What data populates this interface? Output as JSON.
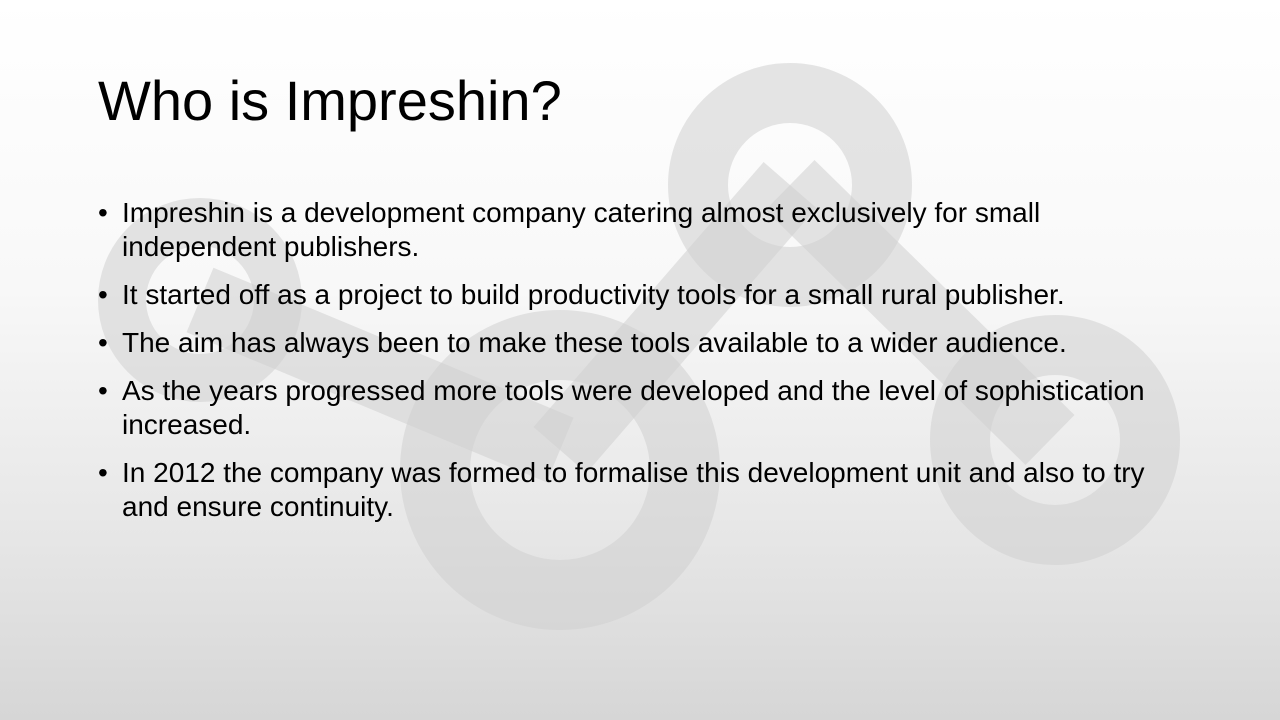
{
  "slide": {
    "title": "Who is Impreshin?",
    "bullet_glyph": "•",
    "watermark_icon": "share-network-icon",
    "bullets": [
      "Impreshin is a development company catering almost exclusively for small independent publishers.",
      "It started off as a project to build productivity tools for a small rural publisher.",
      "The aim has always been to make these tools available to a wider audience.",
      "As the years progressed more tools were developed and the level of sophistication increased.",
      "In 2012 the company was formed to formalise this development unit and also to try and ensure continuity."
    ]
  },
  "colors": {
    "text": "#000000",
    "watermark": "#cfcfcf"
  }
}
